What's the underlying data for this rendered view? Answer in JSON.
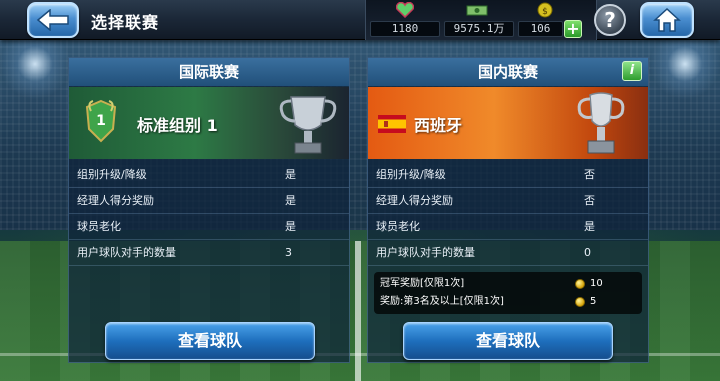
{
  "header": {
    "title": "选择联赛",
    "stats": {
      "gems": "1180",
      "cash": "9575.1万",
      "coins": "106"
    }
  },
  "international": {
    "title": "国际联赛",
    "league_name": "标准组别 1",
    "rank_badge": "1",
    "rows": [
      {
        "label": "组别升级/降级",
        "value": "是"
      },
      {
        "label": "经理人得分奖励",
        "value": "是"
      },
      {
        "label": "球员老化",
        "value": "是"
      },
      {
        "label": "用户球队对手的数量",
        "value": "3"
      }
    ],
    "button_label": "查看球队"
  },
  "domestic": {
    "title": "国内联赛",
    "info_label": "i",
    "league_name": "西班牙",
    "rows": [
      {
        "label": "组别升级/降级",
        "value": "否"
      },
      {
        "label": "经理人得分奖励",
        "value": "否"
      },
      {
        "label": "球员老化",
        "value": "是"
      },
      {
        "label": "用户球队对手的数量",
        "value": "0"
      }
    ],
    "rewards": [
      {
        "label": "冠军奖励[仅限1次]",
        "value": "10"
      },
      {
        "label": "奖励:第3名及以上[仅限1次]",
        "value": "5"
      }
    ],
    "button_label": "查看球队"
  },
  "colors": {
    "accent": "#1e6fbd",
    "international_banner": "#2d7a45",
    "domestic_banner": "#f08a2a",
    "coin": "#d6a40a"
  },
  "icons": [
    "back-arrow-icon",
    "heart-gem-icon",
    "cash-icon",
    "coin-icon",
    "plus-icon",
    "help-icon",
    "home-icon",
    "info-icon",
    "trophy-icon",
    "spain-flag-icon",
    "rank-shield-icon"
  ]
}
